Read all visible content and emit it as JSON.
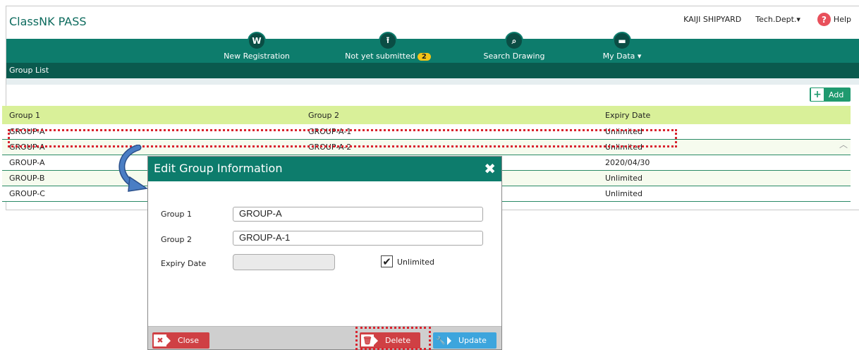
{
  "app": {
    "brand": "ClassNK PASS",
    "user_name": "KAIJI SHIPYARD",
    "department": "Tech.Dept.▾",
    "help_label": "Help"
  },
  "nav": {
    "items": [
      {
        "label": "New Registration",
        "icon": "registration-icon",
        "glyph": "W"
      },
      {
        "label": "Not yet submitted",
        "icon": "upload-icon",
        "glyph": "⭱",
        "badge": "2"
      },
      {
        "label": "Search Drawing",
        "icon": "search-icon",
        "glyph": "⌕"
      },
      {
        "label": "My Data ▾",
        "icon": "folder-icon",
        "glyph": "▬"
      }
    ]
  },
  "subbar": {
    "title": "Group List"
  },
  "toolbar": {
    "add_label": "Add"
  },
  "table": {
    "headers": [
      "Group 1",
      "Group 2",
      "Expiry Date"
    ],
    "rows": [
      [
        "GROUP-A",
        "GROUP-A-1",
        "Unlimited"
      ],
      [
        "GROUP-A",
        "GROUP-A-2",
        "Unlimited"
      ],
      [
        "GROUP-A",
        "",
        "2020/04/30"
      ],
      [
        "GROUP-B",
        "",
        "Unlimited"
      ],
      [
        "GROUP-C",
        "",
        "Unlimited"
      ]
    ]
  },
  "modal": {
    "title": "Edit Group Information",
    "group1_label": "Group 1",
    "group1_value": "GROUP-A",
    "group2_label": "Group 2",
    "group2_value": "GROUP-A-1",
    "expiry_label": "Expiry Date",
    "expiry_value": "",
    "unlimited_label": "Unlimited",
    "unlimited_checked": true,
    "close_label": "Close",
    "delete_label": "Delete",
    "update_label": "Update"
  },
  "colors": {
    "primary": "#0d7c6c",
    "header_row": "#d9f099",
    "danger": "#cf4044",
    "info": "#3da5dd",
    "annotation": "#d9232e"
  }
}
